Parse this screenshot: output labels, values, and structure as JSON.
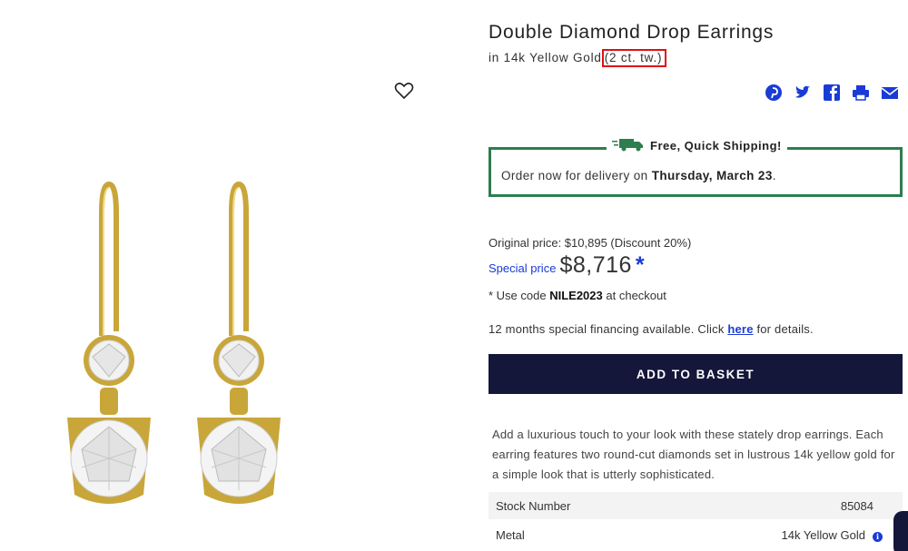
{
  "product": {
    "title": "Double Diamond Drop Earrings",
    "subtitle_metal": "in 14k Yellow Gold",
    "subtitle_carat": "(2 ct. tw.)"
  },
  "share_icons": [
    "pinterest-icon",
    "twitter-icon",
    "facebook-icon",
    "print-icon",
    "email-icon"
  ],
  "shipping": {
    "heading": "Free, Quick Shipping!",
    "text_prefix": "Order now for delivery on",
    "delivery_date": "Thursday, March 23",
    "text_suffix": "."
  },
  "pricing": {
    "original_label": "Original price: $10,895 (Discount 20%)",
    "special_label": "Special price",
    "special_price": "$8,716",
    "asterisk": "*",
    "code_prefix": "* Use code",
    "code": "NILE2023",
    "code_suffix": "at checkout"
  },
  "financing": {
    "prefix": "12 months special financing available. Click",
    "link": "here",
    "suffix": "for details."
  },
  "actions": {
    "add_to_basket": "ADD TO BASKET"
  },
  "description": "Add a luxurious touch to your look with these stately drop earrings. Each earring features two round-cut diamonds set in lustrous 14k yellow gold for a simple look that is utterly sophisticated.",
  "specs": [
    {
      "label": "Stock Number",
      "value": "85084"
    },
    {
      "label": "Metal",
      "value": "14k Yellow Gold"
    }
  ],
  "colors": {
    "accent_blue": "#1a3bd6",
    "button_navy": "#14163a",
    "shipping_green": "#2e7d4f",
    "highlight_red": "#e01010",
    "gold": "#d4b24a"
  }
}
